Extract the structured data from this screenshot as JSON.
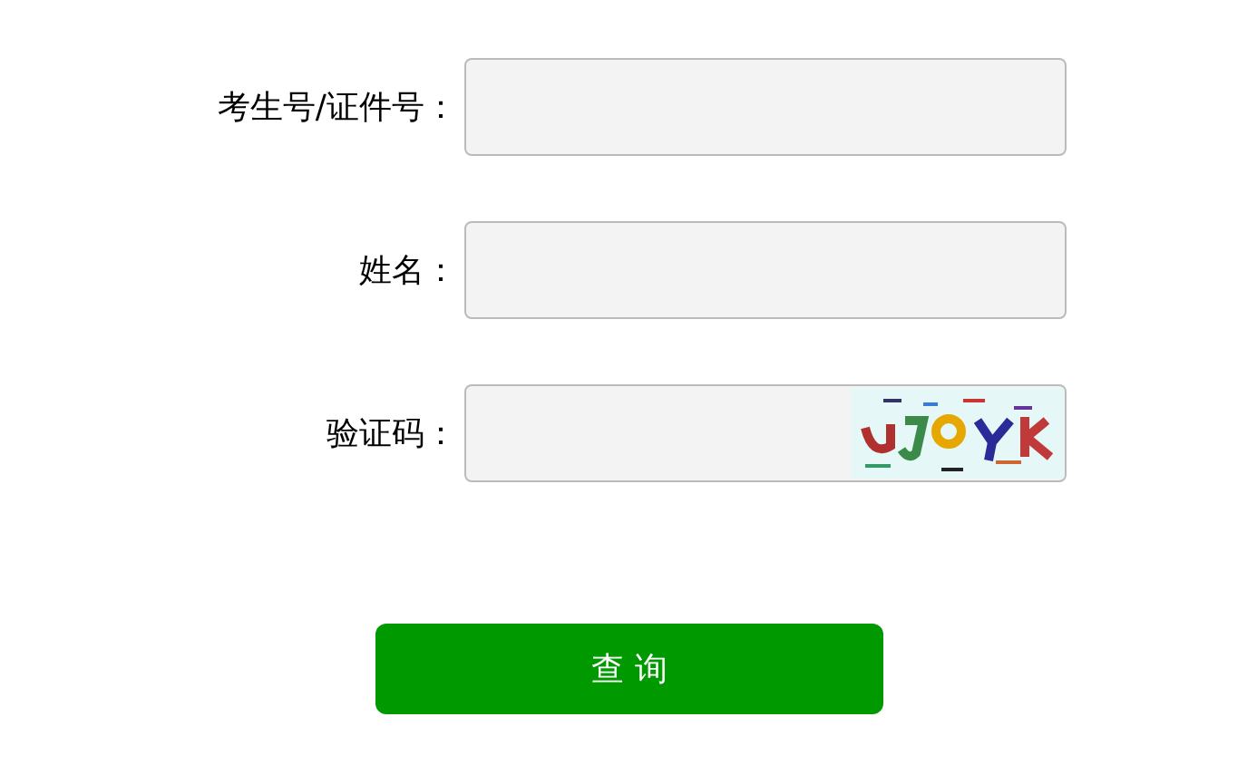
{
  "form": {
    "fields": [
      {
        "label": "考生号/证件号：",
        "kind": "text"
      },
      {
        "label": "姓名：",
        "kind": "text"
      },
      {
        "label": "验证码：",
        "kind": "captcha"
      }
    ]
  },
  "submit": {
    "label": "查 询"
  }
}
